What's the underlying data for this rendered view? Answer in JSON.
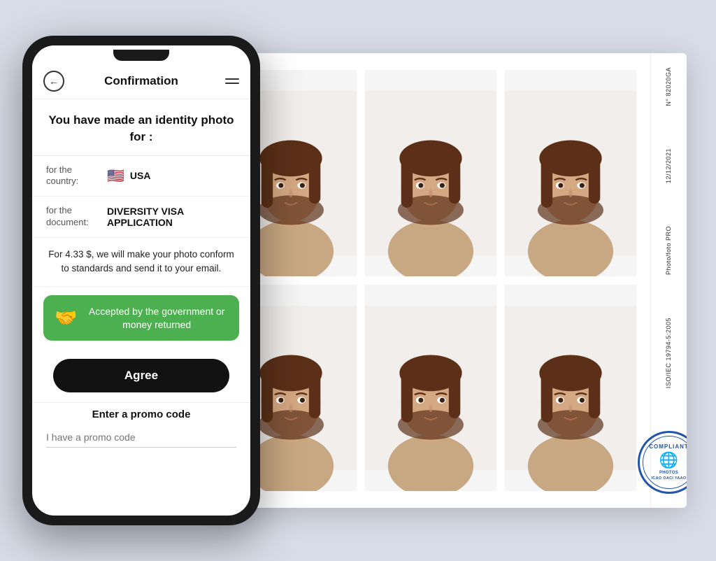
{
  "phone": {
    "nav": {
      "back_icon": "←",
      "title": "Confirmation",
      "menu_icon": "≡"
    },
    "headline": "You have made an identity photo for :",
    "country_label": "for the country:",
    "country_flag": "🇺🇸",
    "country_name": "USA",
    "document_label": "for the document:",
    "document_name": "DIVERSITY VISA APPLICATION",
    "price_text": "For 4.33 $, we will make your photo conform to standards and send it to your email.",
    "guarantee_text": "Accepted by the government or money returned",
    "agree_label": "Agree",
    "promo_heading": "Enter a promo code",
    "promo_placeholder": "I have a promo code"
  },
  "photo_sidebar": {
    "number": "N° 82020GA",
    "date": "12/12/2021",
    "brand": "Photo/foto PRO",
    "standard": "ISO/IEC 19794-5:2005",
    "stamp_line1": "COMPLIANT",
    "stamp_line2": "PHOTOS",
    "stamp_line3": "ICAO OACI YAAO"
  },
  "colors": {
    "guarantee_green": "#4caf50",
    "agree_black": "#111111",
    "stamp_blue": "#2255aa"
  }
}
